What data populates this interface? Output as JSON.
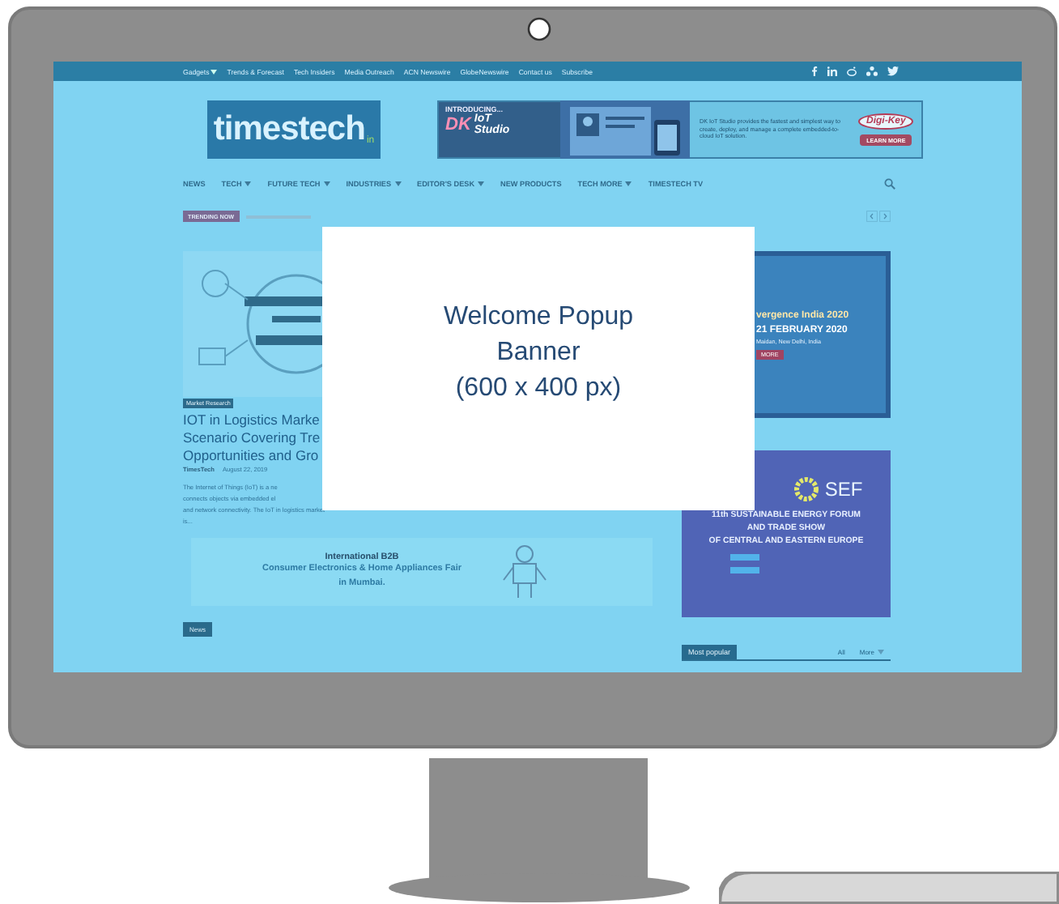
{
  "top_bar": {
    "links": [
      {
        "label": "Gadgets",
        "dropdown": true
      },
      {
        "label": "Trends & Forecast",
        "dropdown": false
      },
      {
        "label": "Tech Insiders",
        "dropdown": false
      },
      {
        "label": "Media Outreach",
        "dropdown": false
      },
      {
        "label": "ACN Newswire",
        "dropdown": false
      },
      {
        "label": "GlobeNewswire",
        "dropdown": false
      },
      {
        "label": "Contact us",
        "dropdown": false
      },
      {
        "label": "Subscribe",
        "dropdown": false
      }
    ]
  },
  "header": {
    "logo": {
      "name": "timestech",
      "suffix": "in"
    },
    "ad": {
      "intro": "INTRODUCING...",
      "mark": "DK",
      "product_lines": [
        "IoT",
        "Studio"
      ],
      "text": "DK IoT Studio provides the fastest and simplest way to create, deploy, and manage a complete embedded-to-cloud IoT solution.",
      "brand": "Digi-Key",
      "button": "LEARN MORE"
    }
  },
  "nav": {
    "items": [
      {
        "label": "NEWS",
        "dropdown": false
      },
      {
        "label": "TECH",
        "dropdown": true
      },
      {
        "label": "FUTURE TECH",
        "dropdown": true
      },
      {
        "label": "INDUSTRIES",
        "dropdown": true
      },
      {
        "label": "EDITOR'S DESK",
        "dropdown": true
      },
      {
        "label": "NEW PRODUCTS",
        "dropdown": false
      },
      {
        "label": "TECH MORE",
        "dropdown": true
      },
      {
        "label": "TIMESTECH TV",
        "dropdown": false
      }
    ]
  },
  "trending": {
    "badge": "TRENDING NOW"
  },
  "featured": {
    "tag": "Market Research",
    "title_lines": [
      "IOT in Logistics Marke",
      "Scenario Covering Tre",
      "Opportunities and Gro"
    ],
    "author": "TimesTech",
    "date": "August 22, 2019",
    "excerpt_lines": [
      "The Internet of Things (IoT) is a ne",
      "connects objects via embedded el",
      "and network connectivity. The IoT in logistics market",
      "is..."
    ]
  },
  "side_ads": [
    {
      "kind": "convergence",
      "lines": [
        "vergence India 2020",
        "21 FEBRUARY 2020",
        "Maidan, New Delhi, India"
      ],
      "button": "MORE"
    },
    {
      "kind": "sef",
      "logo": "SEF",
      "lines": [
        "11th SUSTAINABLE ENERGY FORUM",
        "AND TRADE SHOW",
        "OF CENTRAL AND EASTERN EUROPE"
      ]
    }
  ],
  "b2b_banner": {
    "lines": [
      "International B2B",
      "Consumer Electronics & Home Appliances Fair",
      "in Mumbai."
    ]
  },
  "sections": {
    "news_tab": "News",
    "popular": {
      "title": "Most popular",
      "filters": [
        {
          "label": "All",
          "dropdown": false
        },
        {
          "label": "More",
          "dropdown": true
        }
      ]
    }
  },
  "popup": {
    "lines": [
      "Welcome Popup",
      "Banner",
      "(600 x 400 px)"
    ]
  }
}
